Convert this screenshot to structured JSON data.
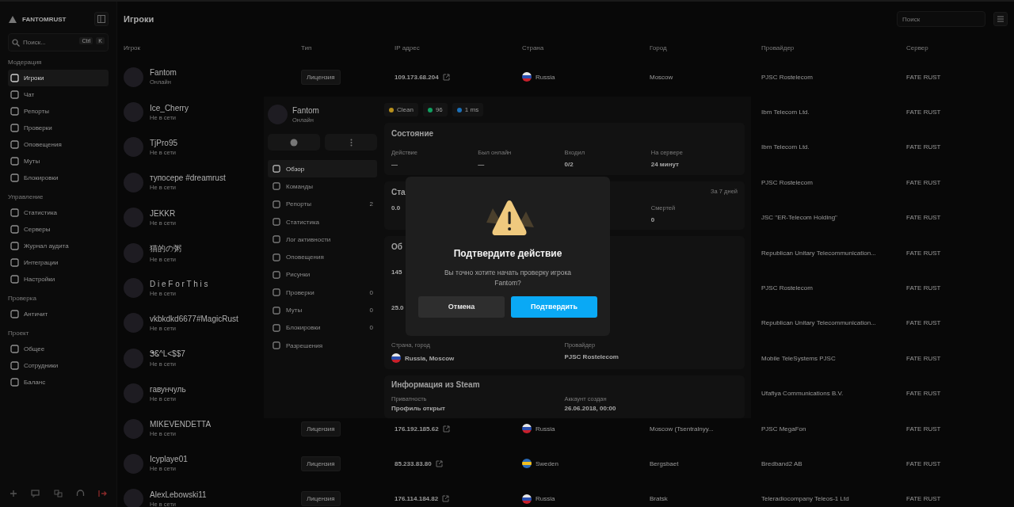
{
  "sidebar": {
    "brand": "FANTOMRUST",
    "search": {
      "placeholder": "Поиск...",
      "keys": [
        "Ctrl",
        "K"
      ]
    },
    "sections": [
      {
        "title": "Модерация",
        "items": [
          {
            "label": "Игроки",
            "selected": true
          },
          {
            "label": "Чат",
            "selected": false
          },
          {
            "label": "Репорты",
            "selected": false
          },
          {
            "label": "Проверки",
            "selected": false
          },
          {
            "label": "Оповещения",
            "selected": false
          },
          {
            "label": "Муты",
            "selected": false
          },
          {
            "label": "Блокировки",
            "selected": false
          }
        ]
      },
      {
        "title": "Управление",
        "items": [
          {
            "label": "Статистика",
            "selected": false
          },
          {
            "label": "Серверы",
            "selected": false
          },
          {
            "label": "Журнал аудита",
            "selected": false
          },
          {
            "label": "Интеграции",
            "selected": false
          },
          {
            "label": "Настройки",
            "selected": false
          }
        ]
      },
      {
        "title": "Проверка",
        "items": [
          {
            "label": "Античит",
            "selected": false
          }
        ]
      },
      {
        "title": "Проект",
        "items": [
          {
            "label": "Общее",
            "selected": false
          },
          {
            "label": "Сотрудники",
            "selected": false
          },
          {
            "label": "Баланс",
            "selected": false
          }
        ]
      }
    ]
  },
  "header": {
    "title": "Игроки",
    "search_placeholder": "Поиск"
  },
  "table": {
    "columns": [
      "Игрок",
      "Тип",
      "IP адрес",
      "Страна",
      "Город",
      "Провайдер",
      "Сервер"
    ],
    "rows": [
      {
        "name": "Fantom",
        "status": "Онлайн",
        "type": "Лицензия",
        "ip": "109.173.68.204",
        "kind": "ru",
        "country": "Russia",
        "city": "Moscow",
        "provider": "PJSC Rostelecom",
        "server": "FATE RUST"
      },
      {
        "name": "Ice_Cherry",
        "status": "Не в сети",
        "provider": "Ibm Telecom Ltd.",
        "server": "FATE RUST"
      },
      {
        "name": "TjPro95",
        "status": "Не в сети",
        "provider": "Ibm Telecom Ltd.",
        "server": "FATE RUST"
      },
      {
        "name": "тупосере #dreamrust",
        "status": "Не в сети",
        "provider": "PJSC Rostelecom",
        "server": "FATE RUST"
      },
      {
        "name": "JEKKR",
        "status": "Не в сети",
        "provider": "JSC \"ER-Telecom Holding\"",
        "server": "FATE RUST"
      },
      {
        "name": "猫的の粥",
        "status": "Не в сети",
        "provider": "Republican Unitary Telecommunication...",
        "server": "FATE RUST"
      },
      {
        "name": "D i e F o r T h i s",
        "status": "Не в сети",
        "provider": "PJSC Rostelecom",
        "server": "FATE RUST"
      },
      {
        "name": "vkbkdkd6677#MagicRust",
        "status": "Не в сети",
        "provider": "Republican Unitary Telecommunication...",
        "server": "FATE RUST"
      },
      {
        "name": "ᏕᏋ^L<$$7",
        "status": "Не в сети",
        "provider": "Mobile TeleSystems PJSC",
        "server": "FATE RUST"
      },
      {
        "name": "гавунчуль",
        "status": "Не в сети",
        "provider": "Ufafiya Communications B.V.",
        "server": "FATE RUST"
      },
      {
        "name": "MIKEVENDETTA",
        "status": "Не в сети",
        "type": "Лицензия",
        "ip": "176.192.185.62",
        "kind": "ru",
        "country": "Russia",
        "city": "Moscow (Tsentralnyy...",
        "provider": "PJSC MegaFon",
        "server": "FATE RUST"
      },
      {
        "name": "Icyplaye01",
        "status": "Не в сети",
        "type": "Лицензия",
        "ip": "85.233.83.80",
        "kind": "se",
        "country": "Sweden",
        "city": "Bergsbaet",
        "provider": "Bredband2 AB",
        "server": "FATE RUST"
      },
      {
        "name": "AlexLebowski11",
        "status": "Не в сети",
        "type": "Лицензия",
        "ip": "176.114.184.82",
        "kind": "ru",
        "country": "Russia",
        "city": "Bratsk",
        "provider": "Teleradiocompany Teleos-1 Ltd",
        "server": "FATE RUST"
      }
    ]
  },
  "panel": {
    "name": "Fantom",
    "status": "Онлайн",
    "nav": [
      {
        "label": "Обзор",
        "selected": true
      },
      {
        "label": "Команды",
        "selected": false
      },
      {
        "label": "Репорты",
        "count": "2",
        "selected": false
      },
      {
        "label": "Статистика",
        "selected": false
      },
      {
        "label": "Лог активности",
        "selected": false
      },
      {
        "label": "Оповещения",
        "selected": false
      },
      {
        "label": "Рисунки",
        "selected": false
      },
      {
        "label": "Проверки",
        "count": "0",
        "selected": false
      },
      {
        "label": "Муты",
        "count": "0",
        "selected": false
      },
      {
        "label": "Блокировки",
        "count": "0",
        "selected": false
      },
      {
        "label": "Разрешения",
        "selected": false
      }
    ],
    "chips": [
      {
        "label": "Clean",
        "color": "#b8901c"
      },
      {
        "label": "96",
        "color": "#10a060"
      },
      {
        "label": "1 ms",
        "color": "#1c70b8"
      }
    ],
    "state": {
      "title": "Состояние",
      "fields": [
        {
          "label": "Действие",
          "value": "—"
        },
        {
          "label": "Был онлайн",
          "value": "—"
        },
        {
          "label": "Входил",
          "value": "0/2"
        },
        {
          "label": "На сервере",
          "value": "24 минут"
        }
      ]
    },
    "stats": {
      "title": "Ста",
      "period": "За 7 дней",
      "value": "0.0",
      "right_label": "Смертей",
      "right_value": "0"
    },
    "about": {
      "title": "Об",
      "values": [
        "145",
        "25.0"
      ],
      "fields": [
        {
          "label": "Страна, город",
          "value": "Russia, Moscow",
          "kind": "ru"
        },
        {
          "label": "Провайдер",
          "value": "PJSC Rostelecom"
        }
      ]
    },
    "steam": {
      "title": "Информация из Steam",
      "fields": [
        {
          "label": "Приватность",
          "value": "Профиль открыт"
        },
        {
          "label": "Аккаунт создан",
          "value": "26.06.2018, 00:00"
        }
      ]
    }
  },
  "modal": {
    "title": "Подтвердите действие",
    "message": "Вы точно хотите начать проверку игрока Fantom?",
    "cancel": "Отмена",
    "confirm": "Подтвердить"
  }
}
